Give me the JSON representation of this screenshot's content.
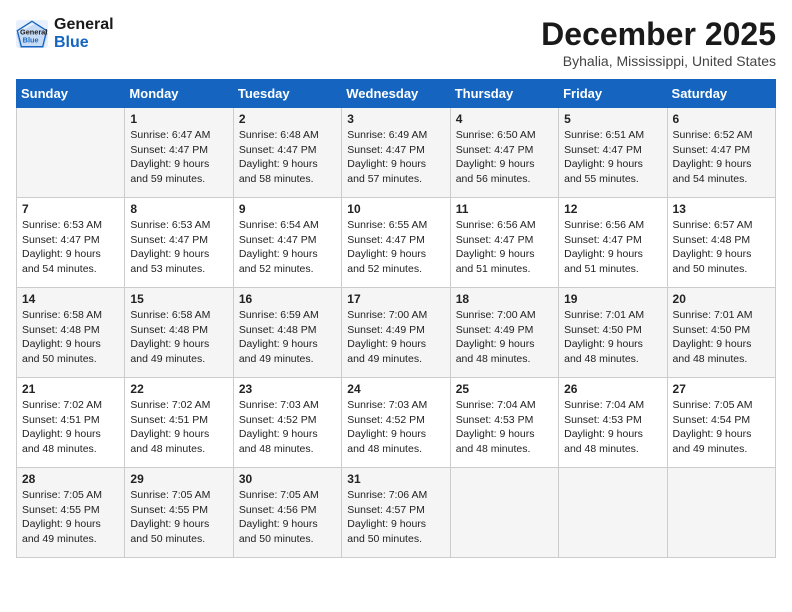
{
  "header": {
    "logo_line1": "General",
    "logo_line2": "Blue",
    "month": "December 2025",
    "location": "Byhalia, Mississippi, United States"
  },
  "days_of_week": [
    "Sunday",
    "Monday",
    "Tuesday",
    "Wednesday",
    "Thursday",
    "Friday",
    "Saturday"
  ],
  "weeks": [
    [
      {
        "day": "",
        "info": ""
      },
      {
        "day": "1",
        "info": "Sunrise: 6:47 AM\nSunset: 4:47 PM\nDaylight: 9 hours\nand 59 minutes."
      },
      {
        "day": "2",
        "info": "Sunrise: 6:48 AM\nSunset: 4:47 PM\nDaylight: 9 hours\nand 58 minutes."
      },
      {
        "day": "3",
        "info": "Sunrise: 6:49 AM\nSunset: 4:47 PM\nDaylight: 9 hours\nand 57 minutes."
      },
      {
        "day": "4",
        "info": "Sunrise: 6:50 AM\nSunset: 4:47 PM\nDaylight: 9 hours\nand 56 minutes."
      },
      {
        "day": "5",
        "info": "Sunrise: 6:51 AM\nSunset: 4:47 PM\nDaylight: 9 hours\nand 55 minutes."
      },
      {
        "day": "6",
        "info": "Sunrise: 6:52 AM\nSunset: 4:47 PM\nDaylight: 9 hours\nand 54 minutes."
      }
    ],
    [
      {
        "day": "7",
        "info": "Sunrise: 6:53 AM\nSunset: 4:47 PM\nDaylight: 9 hours\nand 54 minutes."
      },
      {
        "day": "8",
        "info": "Sunrise: 6:53 AM\nSunset: 4:47 PM\nDaylight: 9 hours\nand 53 minutes."
      },
      {
        "day": "9",
        "info": "Sunrise: 6:54 AM\nSunset: 4:47 PM\nDaylight: 9 hours\nand 52 minutes."
      },
      {
        "day": "10",
        "info": "Sunrise: 6:55 AM\nSunset: 4:47 PM\nDaylight: 9 hours\nand 52 minutes."
      },
      {
        "day": "11",
        "info": "Sunrise: 6:56 AM\nSunset: 4:47 PM\nDaylight: 9 hours\nand 51 minutes."
      },
      {
        "day": "12",
        "info": "Sunrise: 6:56 AM\nSunset: 4:47 PM\nDaylight: 9 hours\nand 51 minutes."
      },
      {
        "day": "13",
        "info": "Sunrise: 6:57 AM\nSunset: 4:48 PM\nDaylight: 9 hours\nand 50 minutes."
      }
    ],
    [
      {
        "day": "14",
        "info": "Sunrise: 6:58 AM\nSunset: 4:48 PM\nDaylight: 9 hours\nand 50 minutes."
      },
      {
        "day": "15",
        "info": "Sunrise: 6:58 AM\nSunset: 4:48 PM\nDaylight: 9 hours\nand 49 minutes."
      },
      {
        "day": "16",
        "info": "Sunrise: 6:59 AM\nSunset: 4:48 PM\nDaylight: 9 hours\nand 49 minutes."
      },
      {
        "day": "17",
        "info": "Sunrise: 7:00 AM\nSunset: 4:49 PM\nDaylight: 9 hours\nand 49 minutes."
      },
      {
        "day": "18",
        "info": "Sunrise: 7:00 AM\nSunset: 4:49 PM\nDaylight: 9 hours\nand 48 minutes."
      },
      {
        "day": "19",
        "info": "Sunrise: 7:01 AM\nSunset: 4:50 PM\nDaylight: 9 hours\nand 48 minutes."
      },
      {
        "day": "20",
        "info": "Sunrise: 7:01 AM\nSunset: 4:50 PM\nDaylight: 9 hours\nand 48 minutes."
      }
    ],
    [
      {
        "day": "21",
        "info": "Sunrise: 7:02 AM\nSunset: 4:51 PM\nDaylight: 9 hours\nand 48 minutes."
      },
      {
        "day": "22",
        "info": "Sunrise: 7:02 AM\nSunset: 4:51 PM\nDaylight: 9 hours\nand 48 minutes."
      },
      {
        "day": "23",
        "info": "Sunrise: 7:03 AM\nSunset: 4:52 PM\nDaylight: 9 hours\nand 48 minutes."
      },
      {
        "day": "24",
        "info": "Sunrise: 7:03 AM\nSunset: 4:52 PM\nDaylight: 9 hours\nand 48 minutes."
      },
      {
        "day": "25",
        "info": "Sunrise: 7:04 AM\nSunset: 4:53 PM\nDaylight: 9 hours\nand 48 minutes."
      },
      {
        "day": "26",
        "info": "Sunrise: 7:04 AM\nSunset: 4:53 PM\nDaylight: 9 hours\nand 48 minutes."
      },
      {
        "day": "27",
        "info": "Sunrise: 7:05 AM\nSunset: 4:54 PM\nDaylight: 9 hours\nand 49 minutes."
      }
    ],
    [
      {
        "day": "28",
        "info": "Sunrise: 7:05 AM\nSunset: 4:55 PM\nDaylight: 9 hours\nand 49 minutes."
      },
      {
        "day": "29",
        "info": "Sunrise: 7:05 AM\nSunset: 4:55 PM\nDaylight: 9 hours\nand 50 minutes."
      },
      {
        "day": "30",
        "info": "Sunrise: 7:05 AM\nSunset: 4:56 PM\nDaylight: 9 hours\nand 50 minutes."
      },
      {
        "day": "31",
        "info": "Sunrise: 7:06 AM\nSunset: 4:57 PM\nDaylight: 9 hours\nand 50 minutes."
      },
      {
        "day": "",
        "info": ""
      },
      {
        "day": "",
        "info": ""
      },
      {
        "day": "",
        "info": ""
      }
    ]
  ]
}
